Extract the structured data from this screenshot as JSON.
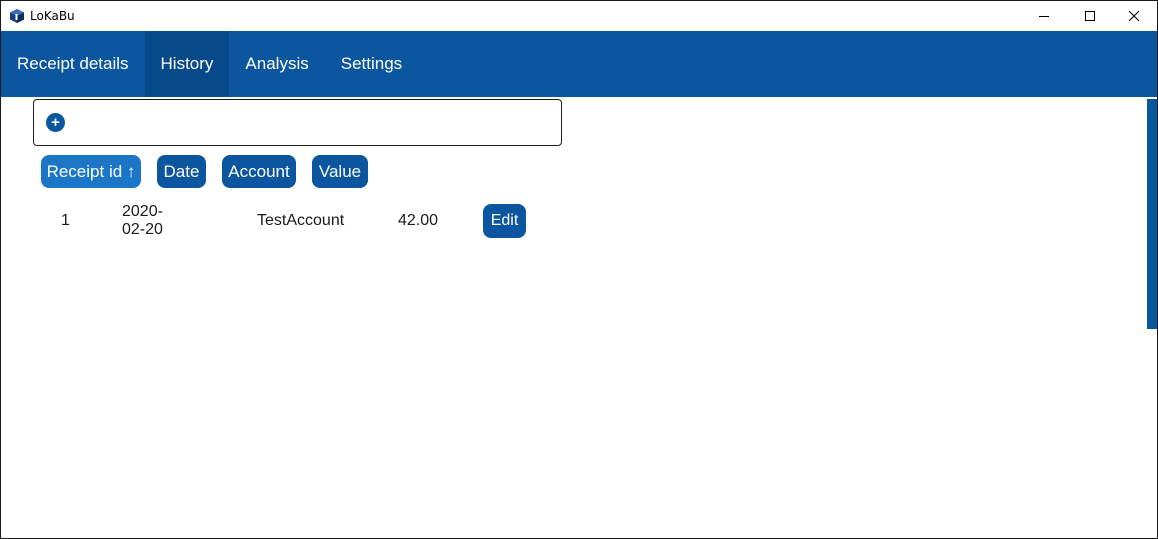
{
  "window": {
    "title": "LoKaBu",
    "icon": "app-cube-icon",
    "controls": [
      "minimize-icon",
      "maximize-icon",
      "close-icon"
    ]
  },
  "nav": {
    "tabs": [
      {
        "label": "Receipt details",
        "active": false
      },
      {
        "label": "History",
        "active": true
      },
      {
        "label": "Analysis",
        "active": false
      },
      {
        "label": "Settings",
        "active": false
      }
    ]
  },
  "search": {
    "add_icon": "+",
    "value": ""
  },
  "table": {
    "columns": [
      {
        "label": "Receipt id ↑",
        "sorted": true
      },
      {
        "label": "Date",
        "sorted": false
      },
      {
        "label": "Account",
        "sorted": false
      },
      {
        "label": "Value",
        "sorted": false
      }
    ],
    "rows": [
      {
        "id": "1",
        "date": "2020-02-20",
        "account": "TestAccount",
        "value": "42.00",
        "action": "Edit"
      }
    ]
  },
  "colors": {
    "accent": "#0b569e",
    "accent_active_tab": "#074a8a",
    "sorted_header": "#1c76c8"
  }
}
